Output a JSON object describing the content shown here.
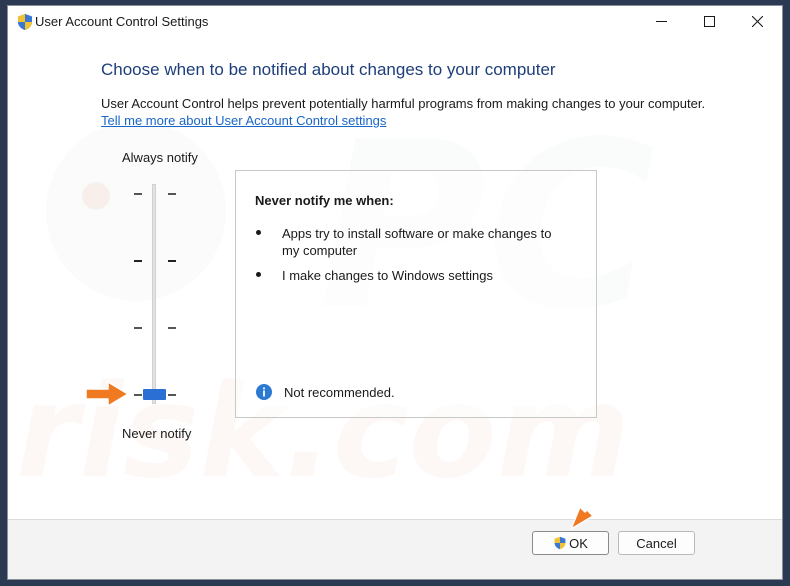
{
  "window": {
    "title": "User Account Control Settings",
    "controls": [
      "minimize",
      "maximize",
      "close"
    ]
  },
  "main": {
    "heading": "Choose when to be notified about changes to your computer",
    "description": "User Account Control helps prevent potentially harmful programs from making changes to your computer.",
    "link": "Tell me more about User Account Control settings"
  },
  "slider": {
    "top_label": "Always notify",
    "bottom_label": "Never notify",
    "levels": 4,
    "selected_level": 0
  },
  "info_panel": {
    "title": "Never notify me when:",
    "bullets": [
      "Apps try to install software or make changes to my computer",
      "I make changes to Windows settings"
    ],
    "note": "Not recommended."
  },
  "footer": {
    "ok_label": "OK",
    "cancel_label": "Cancel"
  },
  "colors": {
    "heading": "#1e3e7b",
    "link": "#1a66c8",
    "slider_thumb": "#2b6ed4",
    "annotation_arrow": "#f07a22",
    "info_icon": "#2b79d0"
  },
  "icons": {
    "title_icon": "uac-shield-icon",
    "ok_icon": "uac-shield-icon",
    "note_icon": "info-icon"
  },
  "watermark": "pcrisk.com"
}
